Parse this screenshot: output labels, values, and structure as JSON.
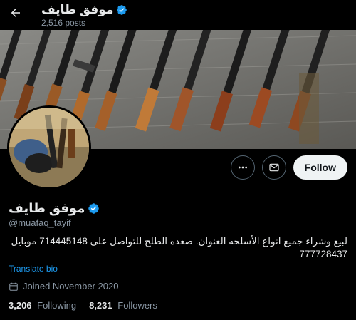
{
  "header": {
    "back_icon": "arrow-left-icon",
    "title": "موفق طايف",
    "verified_icon": "verified-badge-icon",
    "posts_count": "2,516 posts"
  },
  "banner": {
    "description_icon": "banner-image"
  },
  "actions": {
    "more_icon": "more-horizontal-icon",
    "message_icon": "envelope-icon",
    "follow_label": "Follow"
  },
  "profile": {
    "display_name": "موفق طايف",
    "handle": "@muafaq_tayif",
    "bio_line1": "لبيع وشراء جميع انواع الأسلحه العنوان. صعده الطلح للتواصل على  714445148  موبايل",
    "bio_line2": "777728437",
    "translate_label": "Translate bio",
    "joined": "Joined November 2020",
    "following_count": "3,206",
    "following_label": "Following",
    "followers_count": "8,231",
    "followers_label": "Followers"
  },
  "colors": {
    "background": "#000000",
    "text": "#e7e9ea",
    "muted": "#8b98a5",
    "link": "#1d9bf0",
    "verified": "#1d9bf0",
    "follow_bg": "#eff3f4"
  }
}
